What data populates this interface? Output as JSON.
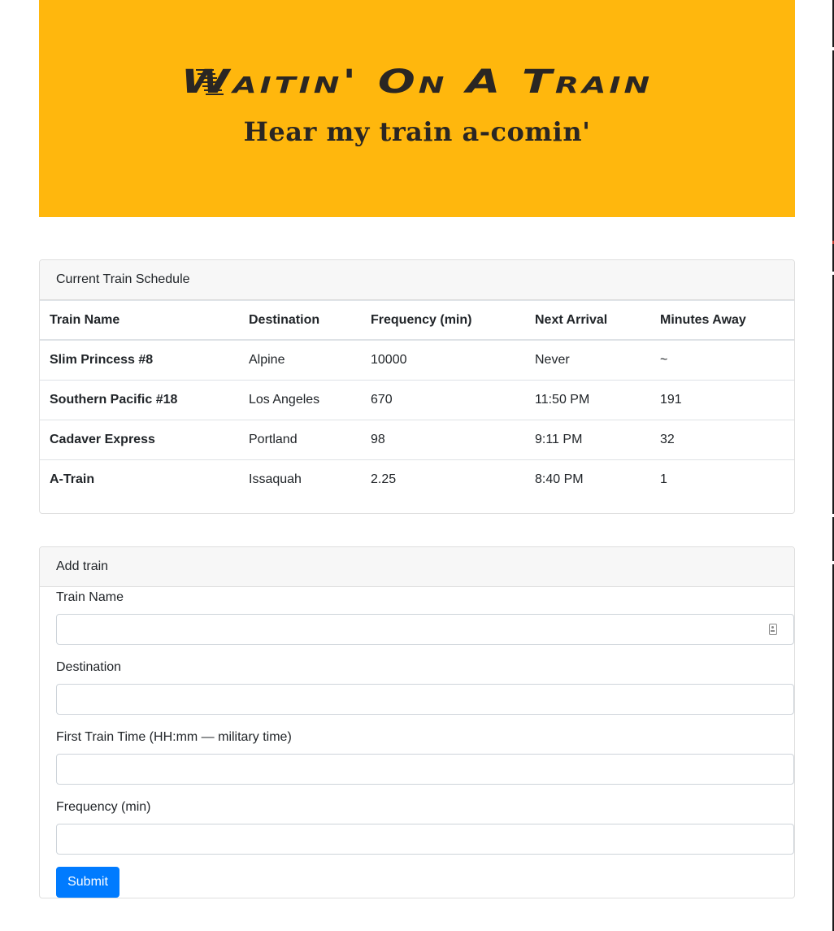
{
  "header": {
    "title": "Waitin' On A Train",
    "subtitle": "Hear my train a-comin'",
    "background_color": "#ffb70d"
  },
  "schedule": {
    "card_title": "Current Train Schedule",
    "columns": [
      "Train Name",
      "Destination",
      "Frequency (min)",
      "Next Arrival",
      "Minutes Away"
    ],
    "rows": [
      [
        "Slim Princess #8",
        "Alpine",
        "10000",
        "Never",
        "~"
      ],
      [
        "Southern Pacific #18",
        "Los Angeles",
        "670",
        "11:50 PM",
        "191"
      ],
      [
        "Cadaver Express",
        "Portland",
        "98",
        "9:11 PM",
        "32"
      ],
      [
        "A-Train",
        "Issaquah",
        "2.25",
        "8:40 PM",
        "1"
      ]
    ]
  },
  "add_train": {
    "card_title": "Add train",
    "fields": [
      {
        "label": "Train Name",
        "value": "",
        "icon": "autofill-contact-icon"
      },
      {
        "label": "Destination",
        "value": ""
      },
      {
        "label": "First Train Time (HH:mm — military time)",
        "value": ""
      },
      {
        "label": "Frequency (min)",
        "value": ""
      }
    ],
    "submit_label": "Submit",
    "submit_color": "#007bff"
  }
}
